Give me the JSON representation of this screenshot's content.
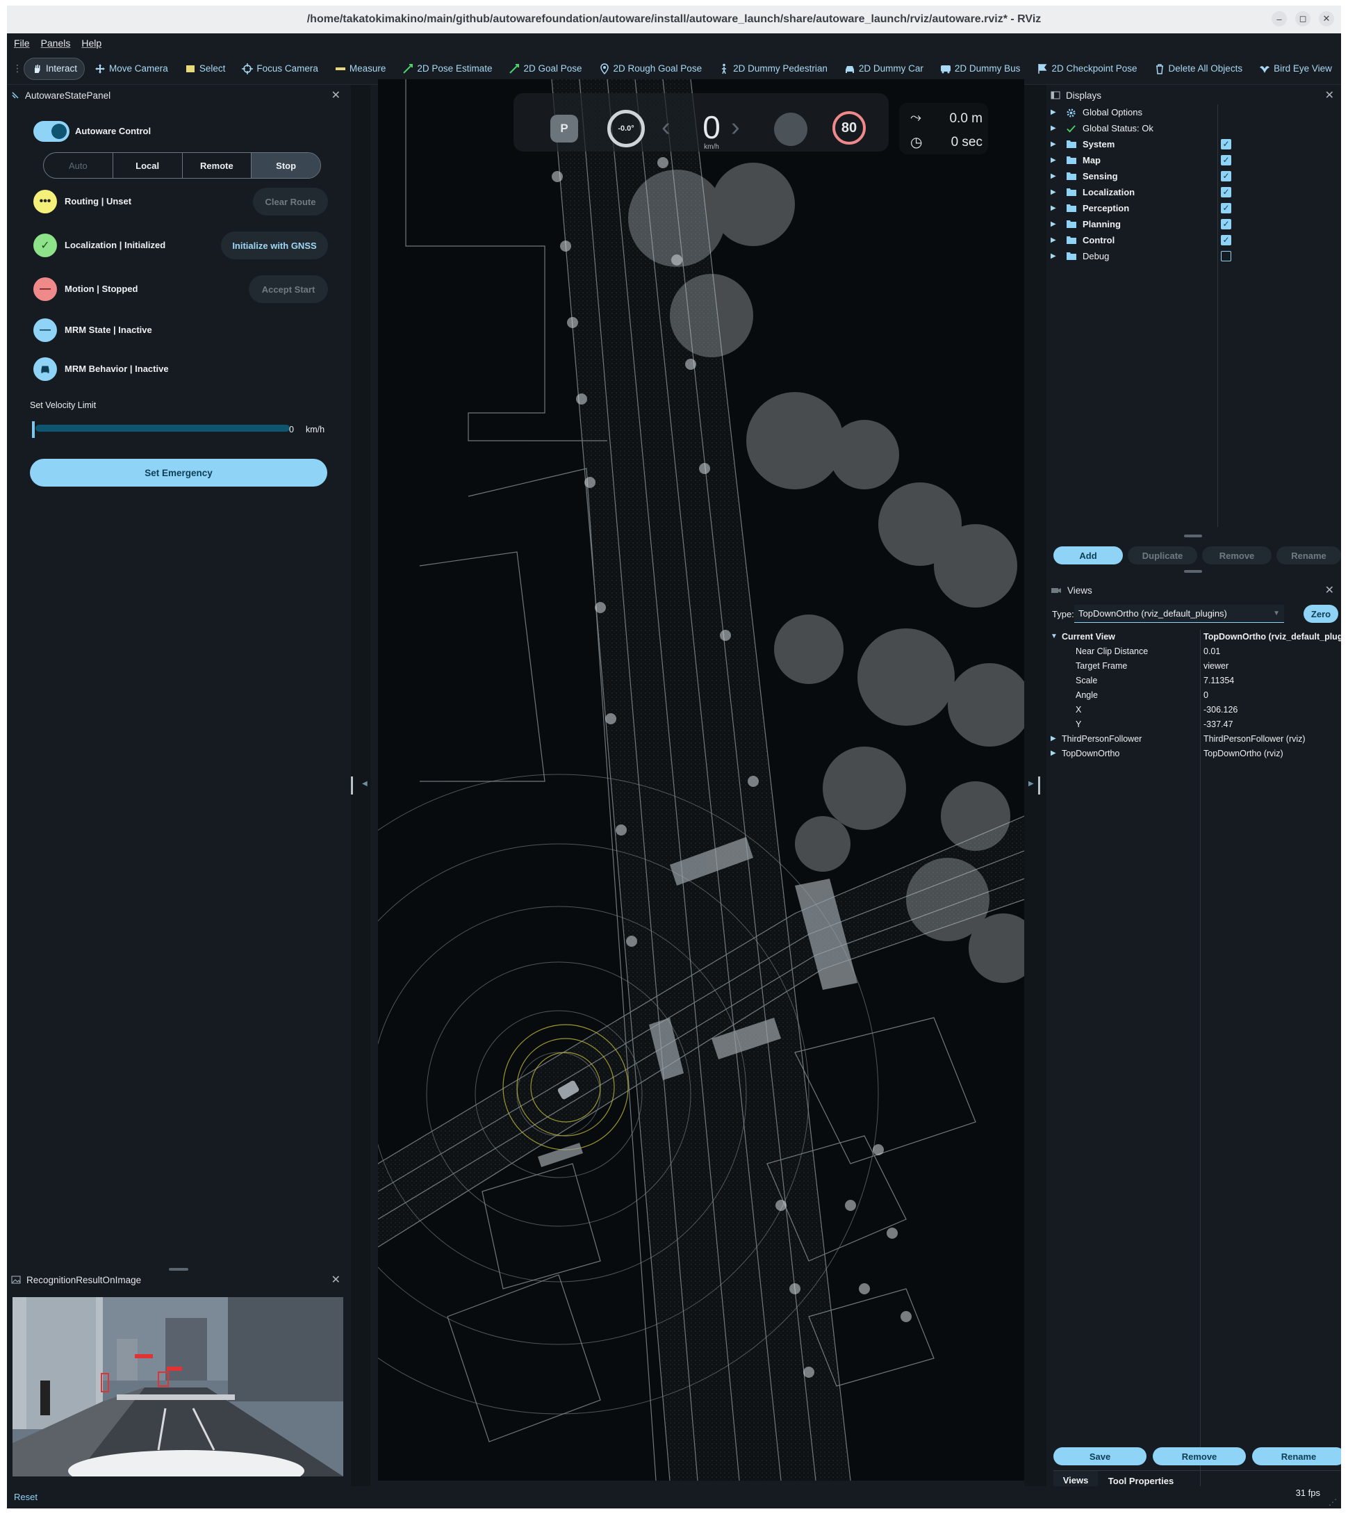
{
  "window": {
    "title": "/home/takatokimakino/main/github/autowarefoundation/autoware/install/autoware_launch/share/autoware_launch/rviz/autoware.rviz* - RViz",
    "min": "–",
    "max": "◻",
    "close": "✕"
  },
  "menu": [
    "File",
    "Panels",
    "Help"
  ],
  "toolbar": [
    "Interact",
    "Move Camera",
    "Select",
    "Focus Camera",
    "Measure",
    "2D Pose Estimate",
    "2D Goal Pose",
    "2D Rough Goal Pose",
    "2D Dummy Pedestrian",
    "2D Dummy Car",
    "2D Dummy Bus",
    "2D Checkpoint Pose",
    "Delete All Objects",
    "Bird Eye View"
  ],
  "state_panel": {
    "title": "AutowareStatePanel",
    "autoware_control": "Autoware Control",
    "modes": [
      "Auto",
      "Local",
      "Remote",
      "Stop"
    ],
    "routing": "Routing | Unset",
    "clear_route": "Clear Route",
    "localization": "Localization | Initialized",
    "init_gnss": "Initialize with GNSS",
    "motion": "Motion | Stopped",
    "accept_start": "Accept Start",
    "mrm_state": "MRM State | Inactive",
    "mrm_behavior": "MRM Behavior | Inactive",
    "velocity_label": "Set Velocity Limit",
    "velocity_value": "0",
    "velocity_unit": "km/h",
    "set_emergency": "Set Emergency"
  },
  "recognition_panel": {
    "title": "RecognitionResultOnImage"
  },
  "hud": {
    "gear": "P",
    "steering": "-0.0°",
    "speed": "0",
    "speed_unit": "km/h",
    "speed_limit": "80",
    "distance": "0.0 m",
    "time": "0 sec"
  },
  "displays": {
    "title": "Displays",
    "items": [
      {
        "label": "Global Options",
        "checked": null,
        "bold": false
      },
      {
        "label": "Global Status: Ok",
        "checked": null,
        "bold": false
      },
      {
        "label": "System",
        "checked": true,
        "bold": true
      },
      {
        "label": "Map",
        "checked": true,
        "bold": true
      },
      {
        "label": "Sensing",
        "checked": true,
        "bold": true
      },
      {
        "label": "Localization",
        "checked": true,
        "bold": true
      },
      {
        "label": "Perception",
        "checked": true,
        "bold": true
      },
      {
        "label": "Planning",
        "checked": true,
        "bold": true
      },
      {
        "label": "Control",
        "checked": true,
        "bold": true
      },
      {
        "label": "Debug",
        "checked": false,
        "bold": false
      }
    ],
    "buttons": [
      "Add",
      "Duplicate",
      "Remove",
      "Rename"
    ]
  },
  "views": {
    "title": "Views",
    "type_label": "Type:",
    "type_value": "TopDownOrtho (rviz_default_plugins)",
    "zero": "Zero",
    "current_view": {
      "label": "Current View",
      "value": "TopDownOrtho (rviz_default_plug..."
    },
    "props": [
      {
        "key": "Near Clip Distance",
        "value": "0.01"
      },
      {
        "key": "Target Frame",
        "value": "viewer"
      },
      {
        "key": "Scale",
        "value": "7.11354"
      },
      {
        "key": "Angle",
        "value": "0"
      },
      {
        "key": "X",
        "value": "-306.126"
      },
      {
        "key": "Y",
        "value": "-337.47"
      }
    ],
    "saved": [
      {
        "key": "ThirdPersonFollower",
        "value": "ThirdPersonFollower (rviz)"
      },
      {
        "key": "TopDownOrtho",
        "value": "TopDownOrtho (rviz)"
      }
    ],
    "buttons": [
      "Save",
      "Remove",
      "Rename"
    ],
    "tabs": [
      "Views",
      "Tool Properties"
    ]
  },
  "status": {
    "reset": "Reset",
    "fps": "31 fps"
  },
  "colors": {
    "accent": "#8fd3f6",
    "accent_dark": "#0e5670",
    "yellow": "#f5f07a",
    "green": "#8ee38a",
    "red": "#f08a8a",
    "blue": "#8fd3f6"
  }
}
